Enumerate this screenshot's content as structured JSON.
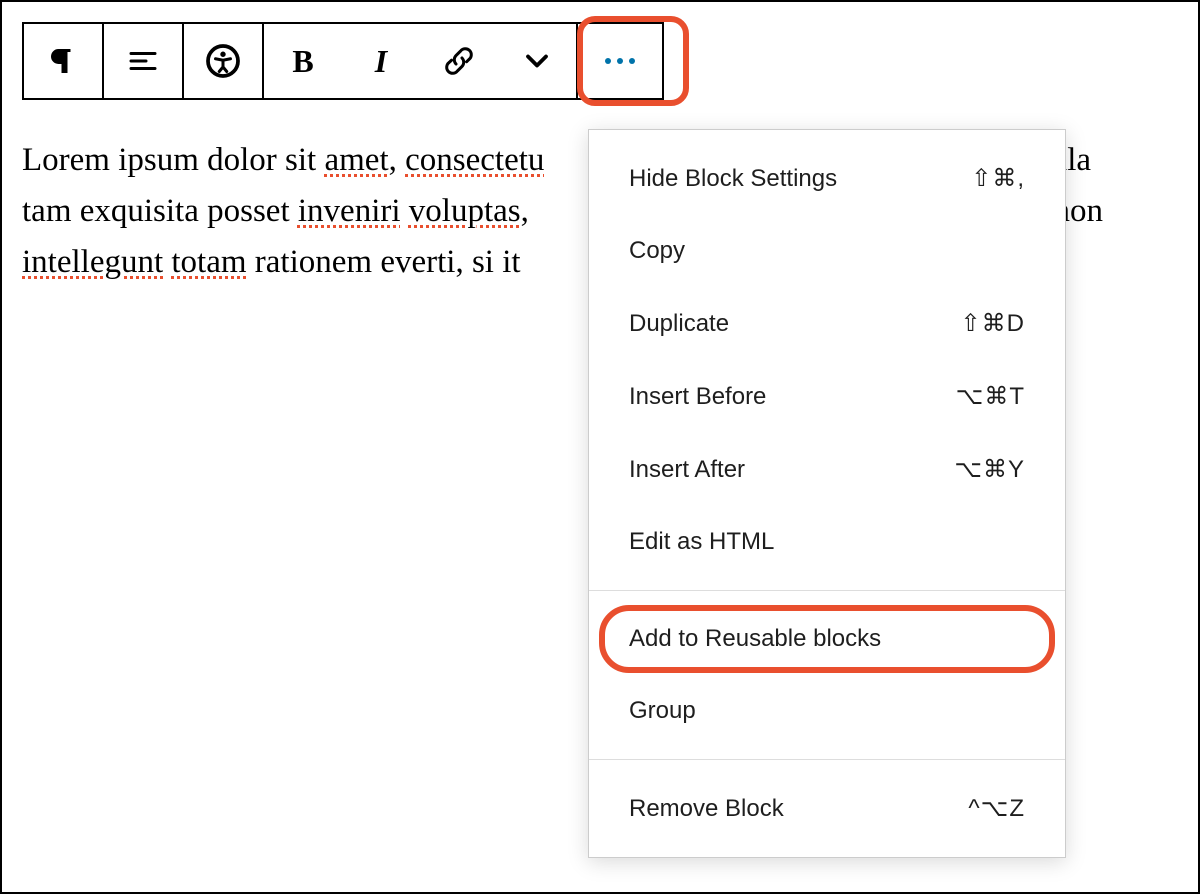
{
  "toolbar": {
    "bold_label": "B",
    "italic_label": "I"
  },
  "content": {
    "text_before_amet": "Lorem ipsum dolor sit ",
    "amet": "amet",
    "text_before_consectetur": ", ",
    "consectetur_visible": "consectetu",
    "text_gap1": "",
    "nulla_visible": "t nulla",
    "line2_before_inveniri": "tam exquisita posset ",
    "inveniri": "inveniri",
    "text_before_voluptas": " ",
    "voluptas": "voluptas",
    "voluptas_comma": ",",
    "timi_visible": "timi non",
    "line3_before_intellegunt": "",
    "intellegunt": "intellegunt",
    "text_before_totam": " ",
    "totam": "totam",
    "line3_after_totam": " rationem everti, si it"
  },
  "menu": {
    "hide_block_settings": {
      "label": "Hide Block Settings",
      "shortcut": "⇧⌘,"
    },
    "copy": {
      "label": "Copy",
      "shortcut": ""
    },
    "duplicate": {
      "label": "Duplicate",
      "shortcut": "⇧⌘D"
    },
    "insert_before": {
      "label": "Insert Before",
      "shortcut": "⌥⌘T"
    },
    "insert_after": {
      "label": "Insert After",
      "shortcut": "⌥⌘Y"
    },
    "edit_as_html": {
      "label": "Edit as HTML",
      "shortcut": ""
    },
    "add_to_reusable": {
      "label": "Add to Reusable blocks",
      "shortcut": ""
    },
    "group": {
      "label": "Group",
      "shortcut": ""
    },
    "remove_block": {
      "label": "Remove Block",
      "shortcut": "^⌥Z"
    }
  }
}
